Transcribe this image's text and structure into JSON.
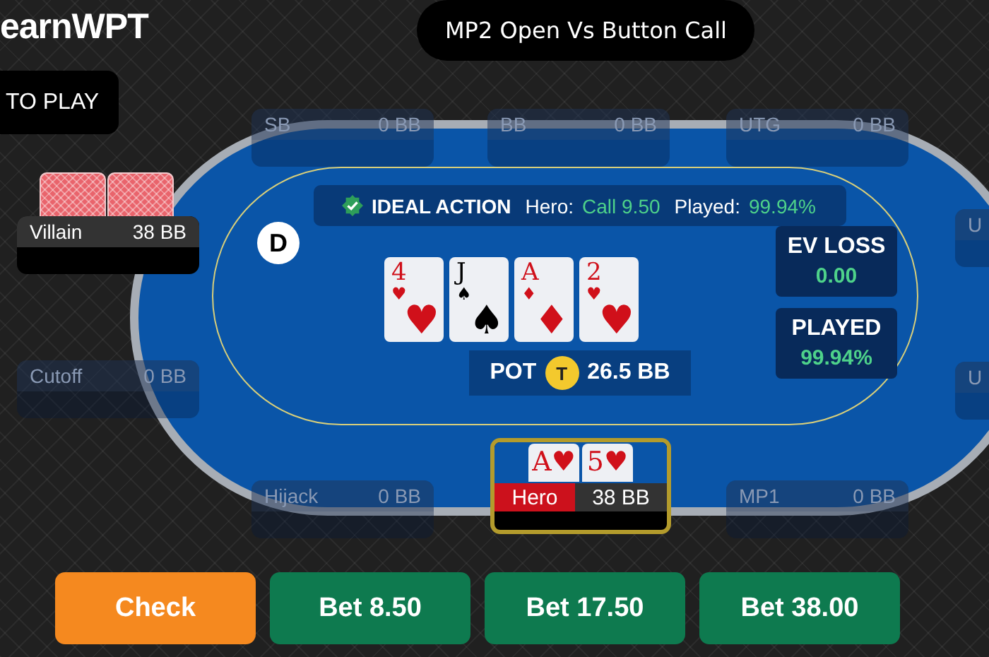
{
  "logo": "earnWPT",
  "title": "MP2 Open Vs Button Call",
  "turn_label": "TO PLAY",
  "seats": [
    {
      "kind": "empty",
      "name": "SB",
      "stack": "0 BB"
    },
    {
      "kind": "empty",
      "name": "BB",
      "stack": "0 BB"
    },
    {
      "kind": "empty",
      "name": "UTG",
      "stack": "0 BB"
    },
    {
      "kind": "empty",
      "name": "U"
    },
    {
      "kind": "villain",
      "name": "Villain",
      "stack": "38 BB"
    },
    {
      "kind": "empty",
      "name": "Cutoff",
      "stack": "0 BB"
    },
    {
      "kind": "empty",
      "name": "U"
    },
    {
      "kind": "empty",
      "name": "Hijack",
      "stack": "0 BB"
    },
    {
      "kind": "hero",
      "name": "Hero",
      "stack": "38 BB",
      "cards": [
        {
          "rank": "A",
          "suit": "♥",
          "color": "#d0101a"
        },
        {
          "rank": "5",
          "suit": "♥",
          "color": "#d0101a"
        }
      ]
    },
    {
      "kind": "empty",
      "name": "MP1",
      "stack": "0 BB"
    }
  ],
  "ideal_action": {
    "label": "IDEAL ACTION",
    "hero_label": "Hero:",
    "hero_value": "Call 9.50",
    "played_label": "Played:",
    "played_value": "99.94%"
  },
  "dealer": "D",
  "board": [
    {
      "rank": "4",
      "pip": "♥",
      "suit": "♥",
      "color": "#d0101a"
    },
    {
      "rank": "J",
      "pip": "♠",
      "suit": "♠",
      "color": "#000000"
    },
    {
      "rank": "A",
      "pip": "♦",
      "suit": "♦",
      "color": "#d0101a"
    },
    {
      "rank": "2",
      "pip": "♥",
      "suit": "♥",
      "color": "#d0101a"
    }
  ],
  "pot": {
    "label": "POT",
    "token": "T",
    "amount": "26.5 BB"
  },
  "stats": [
    {
      "label": "EV LOSS",
      "value": "0.00"
    },
    {
      "label": "PLAYED",
      "value": "99.94%"
    }
  ],
  "actions": [
    {
      "kind": "check",
      "label": "Check"
    },
    {
      "kind": "bet",
      "label": "Bet 8.50"
    },
    {
      "kind": "bet",
      "label": "Bet 17.50"
    },
    {
      "kind": "bet",
      "label": "Bet 38.00"
    }
  ]
}
